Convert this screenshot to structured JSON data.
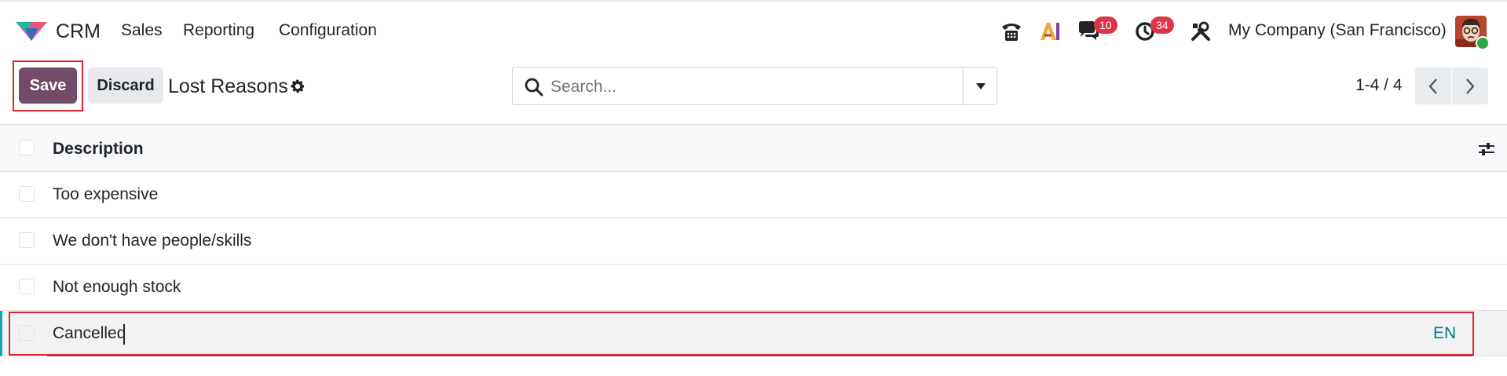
{
  "app": {
    "name": "CRM",
    "menu": [
      "Sales",
      "Reporting",
      "Configuration"
    ]
  },
  "systray": {
    "messages_count": "10",
    "activities_count": "34",
    "company": "My Company (San Francisco)"
  },
  "control_panel": {
    "save_label": "Save",
    "discard_label": "Discard",
    "title": "Lost Reasons",
    "search_placeholder": "Search...",
    "pager": "1-4 / 4"
  },
  "list": {
    "column": "Description",
    "rows": [
      "Too expensive",
      "We don't have people/skills",
      "Not enough stock"
    ],
    "editing_value": "Cancelled",
    "lang": "EN"
  },
  "colors": {
    "brand": "#714b67",
    "highlight": "#e3242b",
    "badge": "#dc3545",
    "link": "#017e84"
  },
  "icons": [
    "crm-logo-icon",
    "phone-icon",
    "ai-icon",
    "chat-icon",
    "clock-icon",
    "tools-icon",
    "gear-icon",
    "search-icon",
    "caret-down-icon",
    "chevron-left-icon",
    "chevron-right-icon",
    "optional-columns-icon"
  ]
}
